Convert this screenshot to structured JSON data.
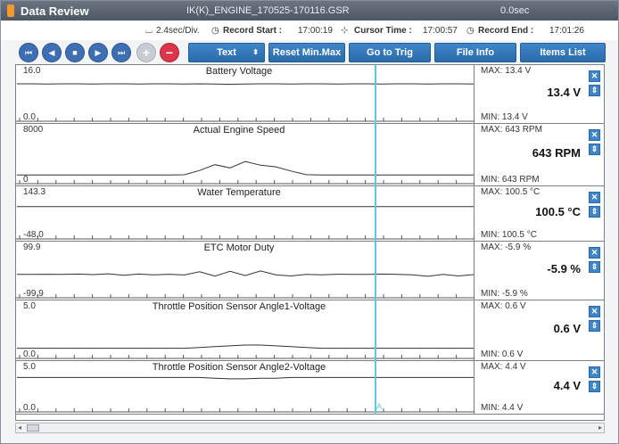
{
  "title_bar": {
    "app_title": "Data Review",
    "file_name": "IK(K)_ENGINE_170525-170116.GSR",
    "time_value": "0.0sec"
  },
  "info_bar": {
    "time_per_div": "2.4sec/Div.",
    "record_start_label": "Record Start :",
    "record_start_value": "17:00:19",
    "cursor_time_label": "Cursor Time :",
    "cursor_time_value": "17:00:57",
    "record_end_label": "Record End :",
    "record_end_value": "17:01:26"
  },
  "toolbar": {
    "first_label": "⏮",
    "prev_label": "◀",
    "stop_label": "■",
    "next_label": "▶",
    "last_label": "⏭",
    "add_label": "+",
    "remove_label": "−",
    "text_select": "Text",
    "reset_minmax": "Reset Min.Max",
    "goto_trig": "Go to Trig",
    "file_info": "File Info",
    "items_list": "Items List"
  },
  "side_controls": {
    "close_glyph": "✕",
    "pin_glyph": "⇕"
  },
  "cursor_marker": "A",
  "scrollbar": {
    "left_arrow": "◂",
    "right_arrow": "▸"
  },
  "panels": [
    {
      "name": "Battery Voltage",
      "ymax": "16.0",
      "ymin": "0.0",
      "max_label": "MAX:  13.4 V",
      "current": "13.4 V",
      "min_label": "MIN:  13.4 V",
      "range": [
        0,
        16
      ],
      "series": [
        13.4,
        13.4,
        13.3,
        13.4,
        13.4,
        13.3,
        13.4,
        13.4,
        13.3,
        13.4,
        13.4,
        13.3,
        13.4,
        13.3,
        13.2,
        13.3,
        13.4,
        13.4,
        13.3,
        13.4,
        13.4,
        13.3,
        13.4,
        13.4,
        13.3,
        13.4,
        13.4,
        13.3,
        13.4,
        13.4,
        13.3
      ]
    },
    {
      "name": "Actual Engine Speed",
      "ymax": "8000",
      "ymin": "0",
      "max_label": "MAX:   643 RPM",
      "current": "643 RPM",
      "min_label": "MIN:   643 RPM",
      "range": [
        0,
        8000
      ],
      "series": [
        640,
        640,
        640,
        645,
        640,
        640,
        640,
        640,
        640,
        640,
        640,
        680,
        1500,
        2600,
        2000,
        3200,
        2500,
        2200,
        1400,
        700,
        640,
        640,
        640,
        640,
        640,
        640,
        640,
        640,
        640,
        640,
        640
      ]
    },
    {
      "name": "Water Temperature",
      "ymax": "143.3",
      "ymin": "-48.0",
      "max_label": "MAX: 100.5 °C",
      "current": "100.5 °C",
      "min_label": "MIN: 100.5 °C",
      "range": [
        -48,
        143.3
      ],
      "series": [
        100.5,
        100.5,
        100.5,
        100.5,
        100.5,
        100.5,
        100.5,
        100.5,
        100.5,
        100.5,
        100.5,
        100.5,
        100.5,
        100.5,
        100.5,
        100.5,
        100.5,
        100.5,
        100.5,
        100.5,
        100.5,
        100.5,
        100.5,
        100.5,
        100.5,
        100.5,
        100.5,
        100.5,
        100.5,
        100.5,
        100.5
      ]
    },
    {
      "name": "ETC Motor Duty",
      "ymax": "99.9",
      "ymin": "-99.9",
      "max_label": "MAX:  -5.9 %",
      "current": "-5.9 %",
      "min_label": "MIN:  -5.9 %",
      "range": [
        -99.9,
        99.9
      ],
      "series": [
        -6,
        -6,
        -5,
        -6,
        -4,
        -7,
        -3,
        -10,
        -4,
        -8,
        -5,
        -9,
        8,
        -15,
        10,
        -12,
        12,
        -8,
        -14,
        -6,
        -8,
        -5,
        -6,
        -6,
        -4,
        -6,
        -8,
        -16,
        -6,
        -14,
        -7
      ]
    },
    {
      "name": "Throttle Position Sensor Angle1-Voltage",
      "ymax": "5.0",
      "ymin": "0.0",
      "max_label": "MAX:   0.6 V",
      "current": "0.6 V",
      "min_label": "MIN:   0.6 V",
      "range": [
        0,
        5
      ],
      "series": [
        0.6,
        0.6,
        0.6,
        0.6,
        0.6,
        0.6,
        0.6,
        0.6,
        0.6,
        0.6,
        0.6,
        0.6,
        0.7,
        0.8,
        0.9,
        1.0,
        1.0,
        0.9,
        0.8,
        0.7,
        0.6,
        0.6,
        0.6,
        0.6,
        0.6,
        0.6,
        0.6,
        0.6,
        0.6,
        0.6,
        0.6
      ]
    },
    {
      "name": "Throttle Position Sensor Angle2-Voltage",
      "ymax": "5.0",
      "ymin": "0.0",
      "max_label": "MAX:   4.4 V",
      "current": "4.4 V",
      "min_label": "MIN:   4.4 V",
      "range": [
        0,
        5
      ],
      "series": [
        4.4,
        4.4,
        4.4,
        4.4,
        4.4,
        4.4,
        4.4,
        4.4,
        4.4,
        4.4,
        4.4,
        4.4,
        4.4,
        4.3,
        4.2,
        4.2,
        4.3,
        4.3,
        4.4,
        4.4,
        4.4,
        4.4,
        4.4,
        4.4,
        4.4,
        4.4,
        4.4,
        4.4,
        4.4,
        4.4,
        4.4
      ]
    }
  ]
}
